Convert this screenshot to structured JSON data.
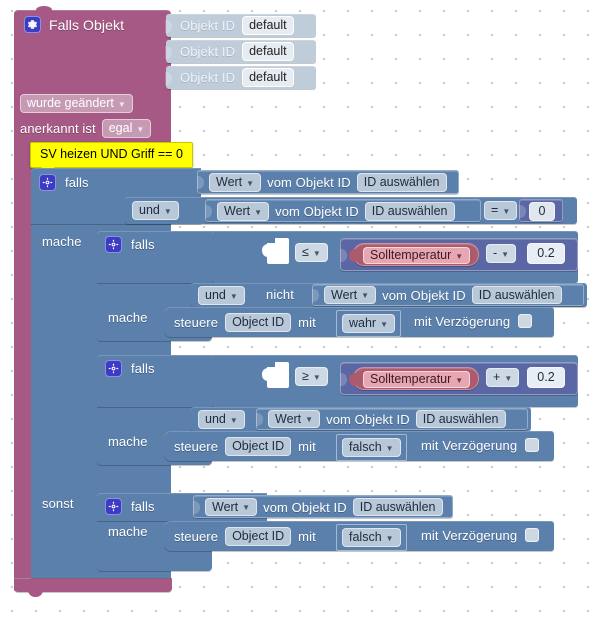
{
  "app": {
    "kind": "blockly-visual-programming-workspace",
    "language": "de",
    "colors": {
      "event_block_pink": "#a55984",
      "logic_block_blue": "#5b80ab",
      "math_block_purple": "#5b67a5",
      "variable_block_red": "#ab5b6b",
      "disabled_block_gray": "#bfccd9",
      "comment_yellow": "#ffff00",
      "gear_icon_blue": "#3b3bc4",
      "canvas_background": "#ffffff"
    }
  },
  "comment": {
    "text": "SV heizen UND Griff == 0"
  },
  "event_block": {
    "title": "Falls Objekt",
    "gear_icon": "gear-icon",
    "trigger_mode": "wurde geändert",
    "ack_label": "anerkannt ist",
    "ack_value": "egal",
    "object_rows": [
      {
        "label": "Objekt ID",
        "value": "default"
      },
      {
        "label": "Objekt ID",
        "value": "default"
      },
      {
        "label": "Objekt ID",
        "value": "default"
      }
    ]
  },
  "outer_if": {
    "if_label": "falls",
    "do_label": "mache",
    "else_label": "sonst",
    "gear_icon": "gear-icon",
    "conditions": [
      {
        "join": "",
        "value_selector": "Wert",
        "from_label": "vom Objekt ID",
        "object_id": "ID auswählen",
        "operator": "",
        "compare_value": ""
      },
      {
        "join": "und",
        "value_selector": "Wert",
        "from_label": "vom Objekt ID",
        "object_id": "ID auswählen",
        "operator": "=",
        "compare_value": "0"
      }
    ]
  },
  "inner_if_1": {
    "if_label": "falls",
    "do_label": "mache",
    "gear_icon": "gear-icon",
    "operator": "≤",
    "variable": "Solltemperatur",
    "math_operator": "-",
    "math_value": "0.2",
    "second_condition": {
      "join": "und",
      "negation": "nicht",
      "value_selector": "Wert",
      "from_label": "vom Objekt ID",
      "object_id": "ID auswählen"
    },
    "action": {
      "verb": "steuere",
      "target": "Object ID",
      "with_label": "mit",
      "state": "wahr",
      "delay_label": "mit Verzögerung",
      "delay_checkbox": "unchecked"
    }
  },
  "inner_if_2": {
    "if_label": "falls",
    "do_label": "mache",
    "gear_icon": "gear-icon",
    "operator": "≥",
    "variable": "Solltemperatur",
    "math_operator": "+",
    "math_value": "0.2",
    "second_condition": {
      "join": "und",
      "value_selector": "Wert",
      "from_label": "vom Objekt ID",
      "object_id": "ID auswählen"
    },
    "action": {
      "verb": "steuere",
      "target": "Object ID",
      "with_label": "mit",
      "state": "falsch",
      "delay_label": "mit Verzögerung",
      "delay_checkbox": "unchecked"
    }
  },
  "else_branch": {
    "if_label": "falls",
    "do_label": "mache",
    "gear_icon": "gear-icon",
    "condition": {
      "value_selector": "Wert",
      "from_label": "vom Objekt ID",
      "object_id": "ID auswählen"
    },
    "action": {
      "verb": "steuere",
      "target": "Object ID",
      "with_label": "mit",
      "state": "falsch",
      "delay_label": "mit Verzögerung",
      "delay_checkbox": "unchecked"
    }
  }
}
